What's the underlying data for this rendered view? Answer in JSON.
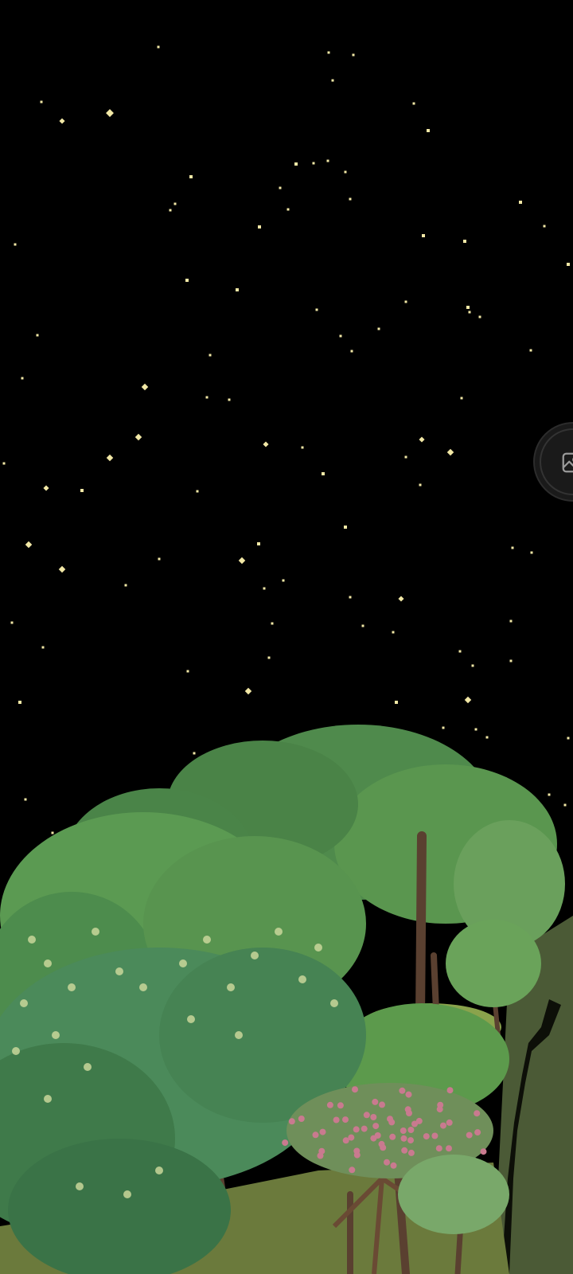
{
  "scene": {
    "sky_color": "#000000",
    "star_color": "#f2e8a6",
    "foliage_colors": [
      "#4f8f4f",
      "#5f9e52",
      "#3f7a4a",
      "#6aa05c",
      "#7bb06a"
    ],
    "blossom_color": "#c97a8f",
    "cliff_color": "#4e5a3a"
  },
  "controls": {
    "gallery_button": {
      "icon": "image-gallery-icon"
    }
  }
}
